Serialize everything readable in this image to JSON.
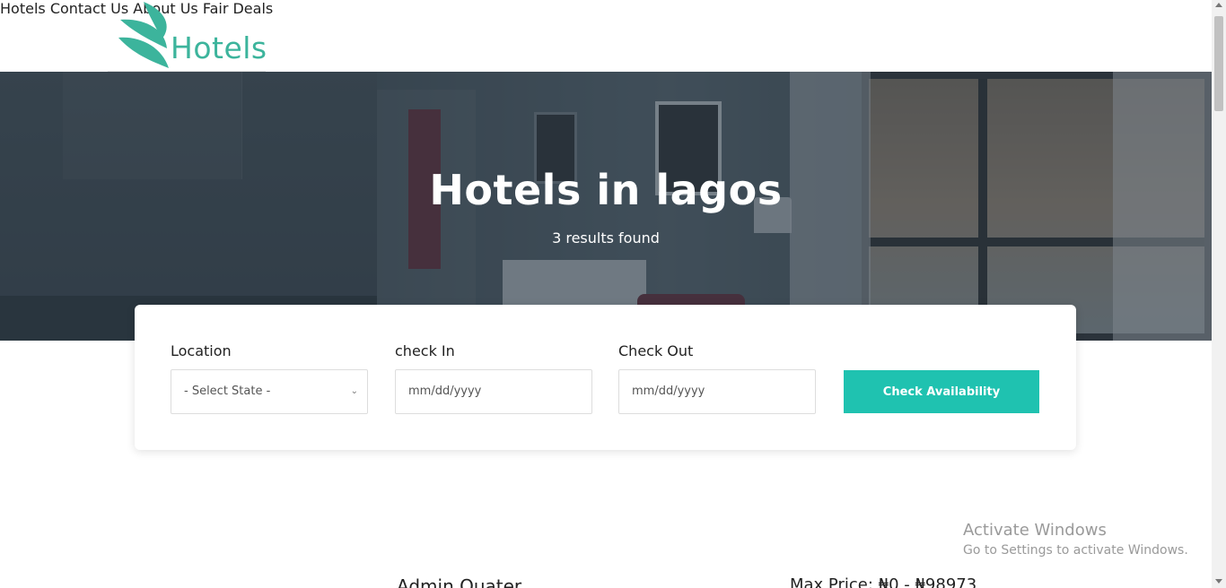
{
  "brand": {
    "logo_text": "Hotels",
    "logo_color": "#3cb49c"
  },
  "nav": {
    "items": [
      {
        "label": "Hotels"
      },
      {
        "label": "Contact Us"
      },
      {
        "label": "About Us"
      },
      {
        "label": "Fair Deals"
      }
    ]
  },
  "hero": {
    "title": "Hotels in lagos",
    "subtitle": "3 results found"
  },
  "search": {
    "location_label": "Location",
    "location_value": "- Select State -",
    "checkin_label": "check In",
    "checkin_placeholder": "mm/dd/yyyy",
    "checkout_label": "Check Out",
    "checkout_placeholder": "mm/dd/yyyy",
    "button_label": "Check Availability",
    "button_color": "#1fc2b0"
  },
  "results": [
    {
      "name": "Admin Quater",
      "price": "Max Price: ₦0 - ₦98973"
    }
  ],
  "watermark": {
    "line1": "Activate Windows",
    "line2": "Go to Settings to activate Windows."
  }
}
